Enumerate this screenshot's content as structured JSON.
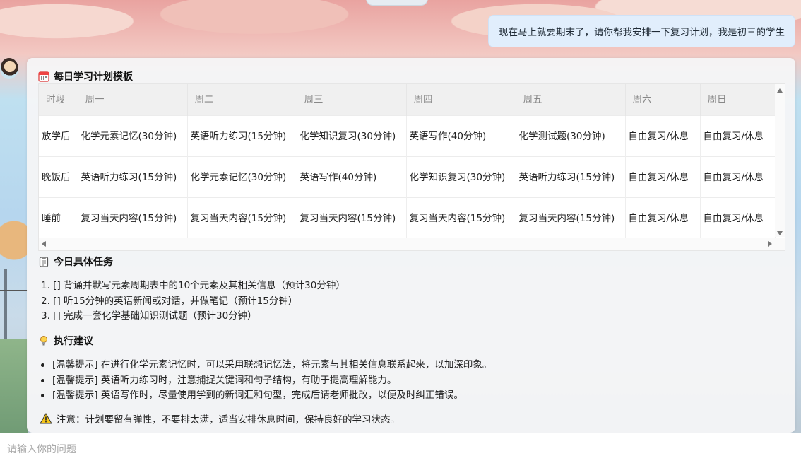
{
  "chat": {
    "user_message": "现在马上就要期末了，请你帮我安排一下复习计划，我是初三的学生"
  },
  "plan": {
    "table_title": "每日学习计划模板",
    "columns": [
      "时段",
      "周一",
      "周二",
      "周三",
      "周四",
      "周五",
      "周六",
      "周日"
    ],
    "rows": [
      [
        "放学后",
        "化学元素记忆(30分钟)",
        "英语听力练习(15分钟)",
        "化学知识复习(30分钟)",
        "英语写作(40分钟)",
        "化学测试题(30分钟)",
        "自由复习/休息",
        "自由复习/休息"
      ],
      [
        "晚饭后",
        "英语听力练习(15分钟)",
        "化学元素记忆(30分钟)",
        "英语写作(40分钟)",
        "化学知识复习(30分钟)",
        "英语听力练习(15分钟)",
        "自由复习/休息",
        "自由复习/休息"
      ],
      [
        "睡前",
        "复习当天内容(15分钟)",
        "复习当天内容(15分钟)",
        "复习当天内容(15分钟)",
        "复习当天内容(15分钟)",
        "复习当天内容(15分钟)",
        "自由复习/休息",
        "自由复习/休息"
      ]
    ],
    "tasks_title": "今日具体任务",
    "tasks": [
      "1. [] 背诵并默写元素周期表中的10个元素及其相关信息（预计30分钟）",
      "2. [] 听15分钟的英语新闻或对话，并做笔记（预计15分钟）",
      "3. [] 完成一套化学基础知识测试题（预计30分钟）"
    ],
    "tips_title": "执行建议",
    "tips": [
      "[温馨提示] 在进行化学元素记忆时，可以采用联想记忆法，将元素与其相关信息联系起来，以加深印象。",
      "[温馨提示] 英语听力练习时，注意捕捉关键词和句子结构，有助于提高理解能力。",
      "[温馨提示] 英语写作时，尽量使用学到的新词汇和句型，完成后请老师批改，以便及时纠正错误。"
    ],
    "note": "注意：计划要留有弹性，不要排太满，适当安排休息时间，保持良好的学习状态。"
  },
  "input": {
    "placeholder": "请输入你的问题"
  },
  "icons": {
    "table": "calendar-icon",
    "tasks": "clipboard-icon",
    "tips": "lightbulb-icon",
    "note": "warning-icon"
  }
}
